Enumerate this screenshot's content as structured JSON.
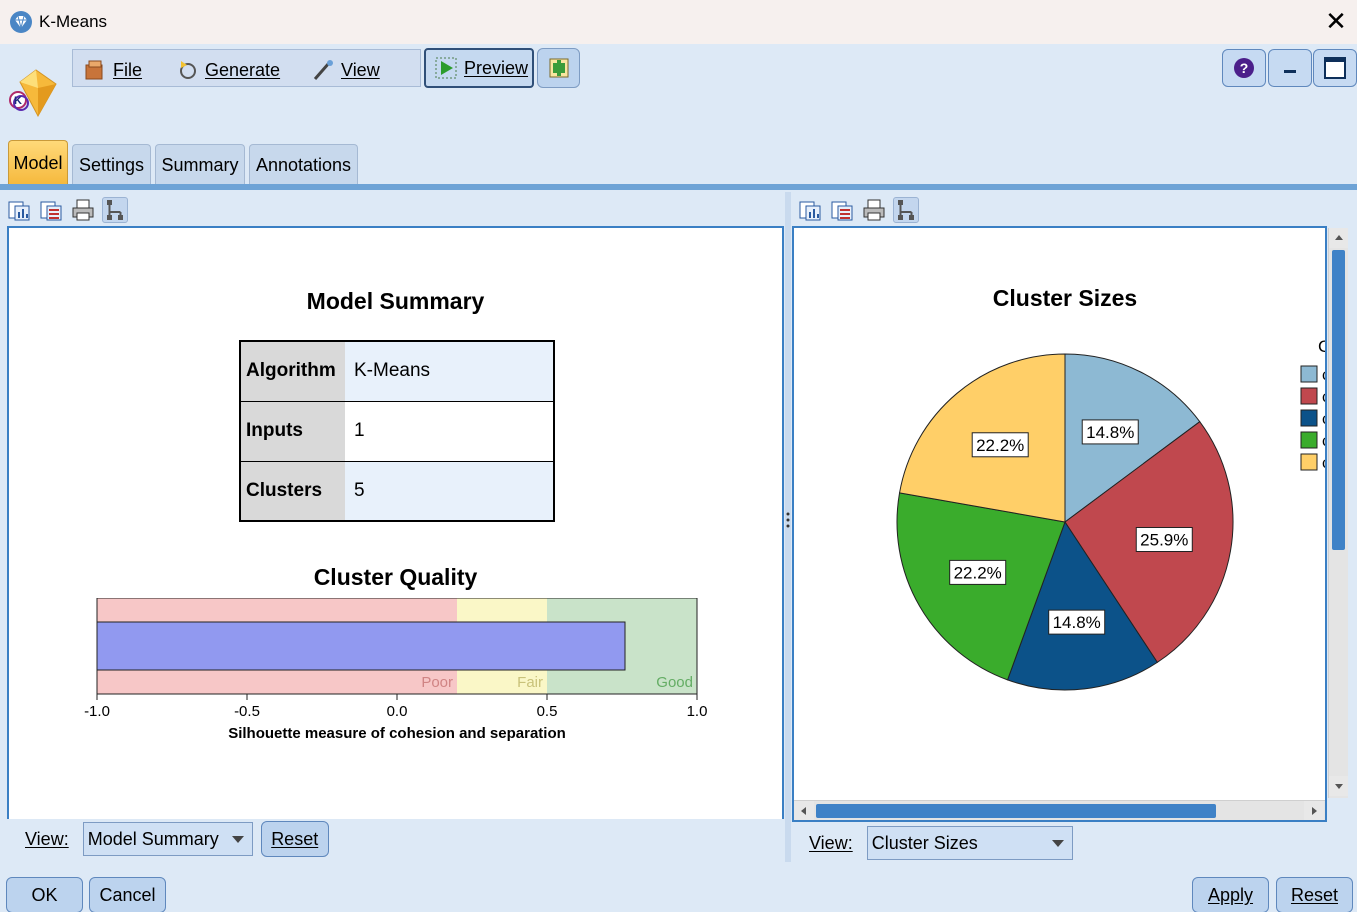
{
  "window": {
    "title": "K-Means",
    "close_label": "✕"
  },
  "menu": {
    "file": "File",
    "generate": "Generate",
    "view": "View",
    "preview": "Preview"
  },
  "tabs": [
    {
      "label": "Model",
      "active": true
    },
    {
      "label": "Settings",
      "active": false
    },
    {
      "label": "Summary",
      "active": false
    },
    {
      "label": "Annotations",
      "active": false
    }
  ],
  "left_panel": {
    "title": "Model Summary",
    "rows": [
      {
        "key": "Algorithm",
        "value": "K-Means"
      },
      {
        "key": "Inputs",
        "value": "1"
      },
      {
        "key": "Clusters",
        "value": "5"
      }
    ],
    "quality_title": "Cluster Quality",
    "quality_chart": {
      "value": 0.76,
      "range": [
        -1.0,
        1.0
      ],
      "bands": [
        {
          "label": "Poor",
          "from": -1.0,
          "to": 0.2,
          "color": "#f7c7c7",
          "text_color": "#d08484"
        },
        {
          "label": "Fair",
          "from": 0.2,
          "to": 0.5,
          "color": "#faf7c7",
          "text_color": "#c9c27a"
        },
        {
          "label": "Good",
          "from": 0.5,
          "to": 1.0,
          "color": "#c9e3c9",
          "text_color": "#64ad64"
        }
      ],
      "bar_color": "#9199f0",
      "ticks": [
        "-1.0",
        "-0.5",
        "0.0",
        "0.5",
        "1.0"
      ],
      "xlabel": "Silhouette measure of cohesion and separation"
    },
    "view_label": "View:",
    "view_value": "Model Summary",
    "reset_label": "Reset"
  },
  "right_panel": {
    "view_label": "View:",
    "view_value": "Cluster Sizes"
  },
  "chart_data": {
    "type": "pie",
    "title": "Cluster Sizes",
    "slices": [
      {
        "label": "14.8%",
        "value": 14.8,
        "color": "#8db9d3"
      },
      {
        "label": "25.9%",
        "value": 25.9,
        "color": "#c0484e"
      },
      {
        "label": "14.8%",
        "value": 14.8,
        "color": "#0c5289"
      },
      {
        "label": "22.2%",
        "value": 22.2,
        "color": "#3aac2c"
      },
      {
        "label": "22.2%",
        "value": 22.2,
        "color": "#ffcf68"
      }
    ],
    "legend": {
      "placement": "right",
      "title": "C",
      "entries": [
        "c",
        "c",
        "c",
        "c",
        "c"
      ]
    }
  },
  "footer": {
    "ok": "OK",
    "cancel": "Cancel",
    "apply": "Apply",
    "reset": "Reset"
  }
}
